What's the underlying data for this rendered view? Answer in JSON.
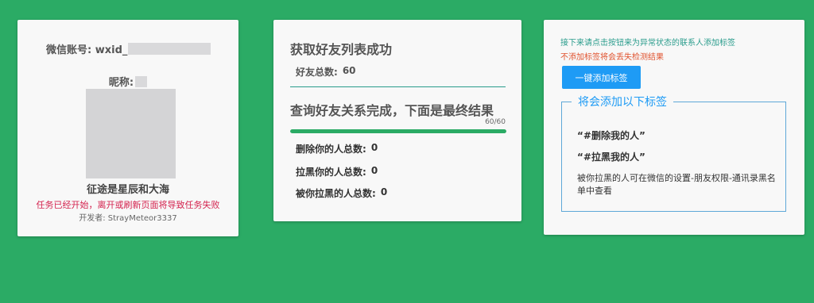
{
  "account_card": {
    "wxid_label": "微信账号: wxid_",
    "nickname_label": "昵称:",
    "motto": "征途是星辰和大海",
    "warning": "任务已经开始，离开或刷新页面将导致任务失败",
    "developer": "开发者: StrayMeteor3337"
  },
  "result_card": {
    "fetch_title": "获取好友列表成功",
    "friend_total_label": "好友总数:",
    "friend_total_value": "60",
    "query_title": "查询好友关系完成，下面是最终结果",
    "progress_text": "60/60",
    "progress_fraction": 1.0,
    "stats": [
      {
        "label": "删除你的人总数:",
        "value": "0"
      },
      {
        "label": "拉黑你的人总数:",
        "value": "0"
      },
      {
        "label": "被你拉黑的人总数:",
        "value": "0"
      }
    ]
  },
  "tags_card": {
    "instruction": "接下来请点击按钮来为异常状态的联系人添加标签",
    "instruction_warning": "不添加标签将会丢失检测结果",
    "add_button": "一键添加标签",
    "legend": "将会添加以下标签",
    "tags": [
      "“#删除我的人”",
      "“#拉黑我的人”"
    ],
    "note": "被你拉黑的人可在微信的设置-朋友权限-通讯录黑名单中查看"
  },
  "colors": {
    "background": "#2bab65",
    "accent_blue": "#1e9bf5",
    "warning_red": "#d4234f",
    "teal": "#2a9c8c"
  }
}
